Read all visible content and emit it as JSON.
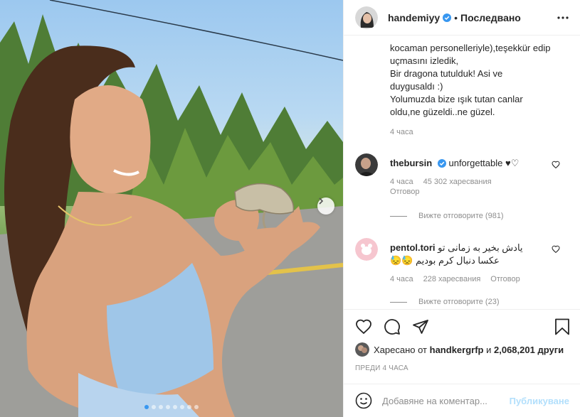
{
  "post": {
    "username": "handemiyy",
    "follow_state": "Последвано",
    "caption_lines": [
      "kocaman personelleriyle),teşekkür edip",
      "uçmasını izledik,",
      "Bir dragona tutulduk! Asi ve",
      "duygusaldı :)",
      "Yolumuzda bize ışık tutan canlar",
      "oldu,ne güzeldi..ne güzel."
    ],
    "caption_time": "4 часа",
    "carousel_total": 8,
    "carousel_active": 1
  },
  "comments": [
    {
      "username": "thebursin",
      "text": "unforgettable ♥♡",
      "time": "4 часа",
      "likes": "45 302 харесвания",
      "reply": "Отговор",
      "view_replies": "Вижте отговорите (981)"
    },
    {
      "username": "pentol.tori",
      "text_line1": "یادش بخیر به زمانی تو",
      "text_line2": "عکسا دنبال کرم بودیم 😓😓",
      "time": "4 часа",
      "likes": "228 харесвания",
      "reply": "Отговор",
      "view_replies": "Вижте отговорите (23)"
    }
  ],
  "likes": {
    "prefix": "Харесано от",
    "user": "handkergrfp",
    "and": "и",
    "count": "2,068,201",
    "others": "други"
  },
  "posted": "ПРЕДИ 4 ЧАСА",
  "add_comment": {
    "placeholder": "Добавяне на коментар...",
    "publish": "Публикуване"
  },
  "colors": {
    "verified": "#3897f0",
    "publish_disabled": "#b2dffc",
    "meta_gray": "#8e8e8e"
  },
  "icons": [
    "verified-badge-icon",
    "more-options-icon",
    "chevron-right-icon",
    "heart-icon",
    "comment-icon",
    "share-icon",
    "bookmark-icon",
    "emoji-icon"
  ]
}
